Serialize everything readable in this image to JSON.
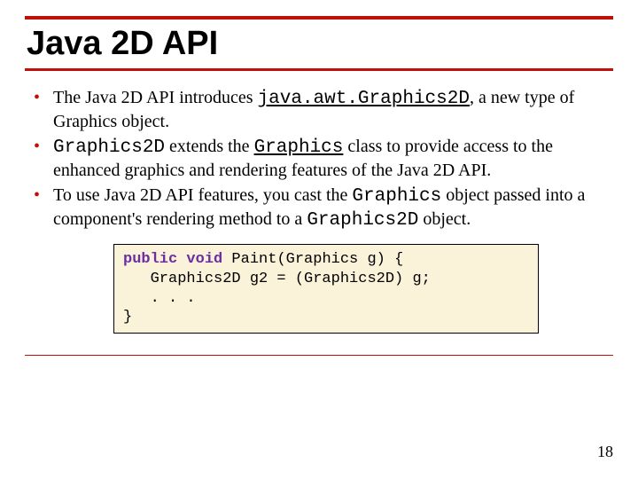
{
  "title": "Java 2D API",
  "bullets": {
    "b1": {
      "t1": "The Java 2D API introduces ",
      "link": "java.awt.Graphics2D",
      "t2": ", a new type of Graphics object."
    },
    "b2": {
      "code1": "Graphics2D",
      "t1": " extends the ",
      "link": "Graphics",
      "t2": " class to provide access to the enhanced graphics and rendering features of the Java 2D API."
    },
    "b3": {
      "t1": "To use Java 2D API features, you cast the ",
      "code1": "Graphics",
      "t2": " object passed into a component's rendering method to a ",
      "code2": "Graphics2D",
      "t3": " object."
    }
  },
  "code": {
    "kw_public": "public",
    "kw_void": "void",
    "sig_rest": " Paint(Graphics g) {",
    "line2": "   Graphics2D g2 = (Graphics2D) g;",
    "line3": "   . . .",
    "line4": "}"
  },
  "page_number": "18"
}
